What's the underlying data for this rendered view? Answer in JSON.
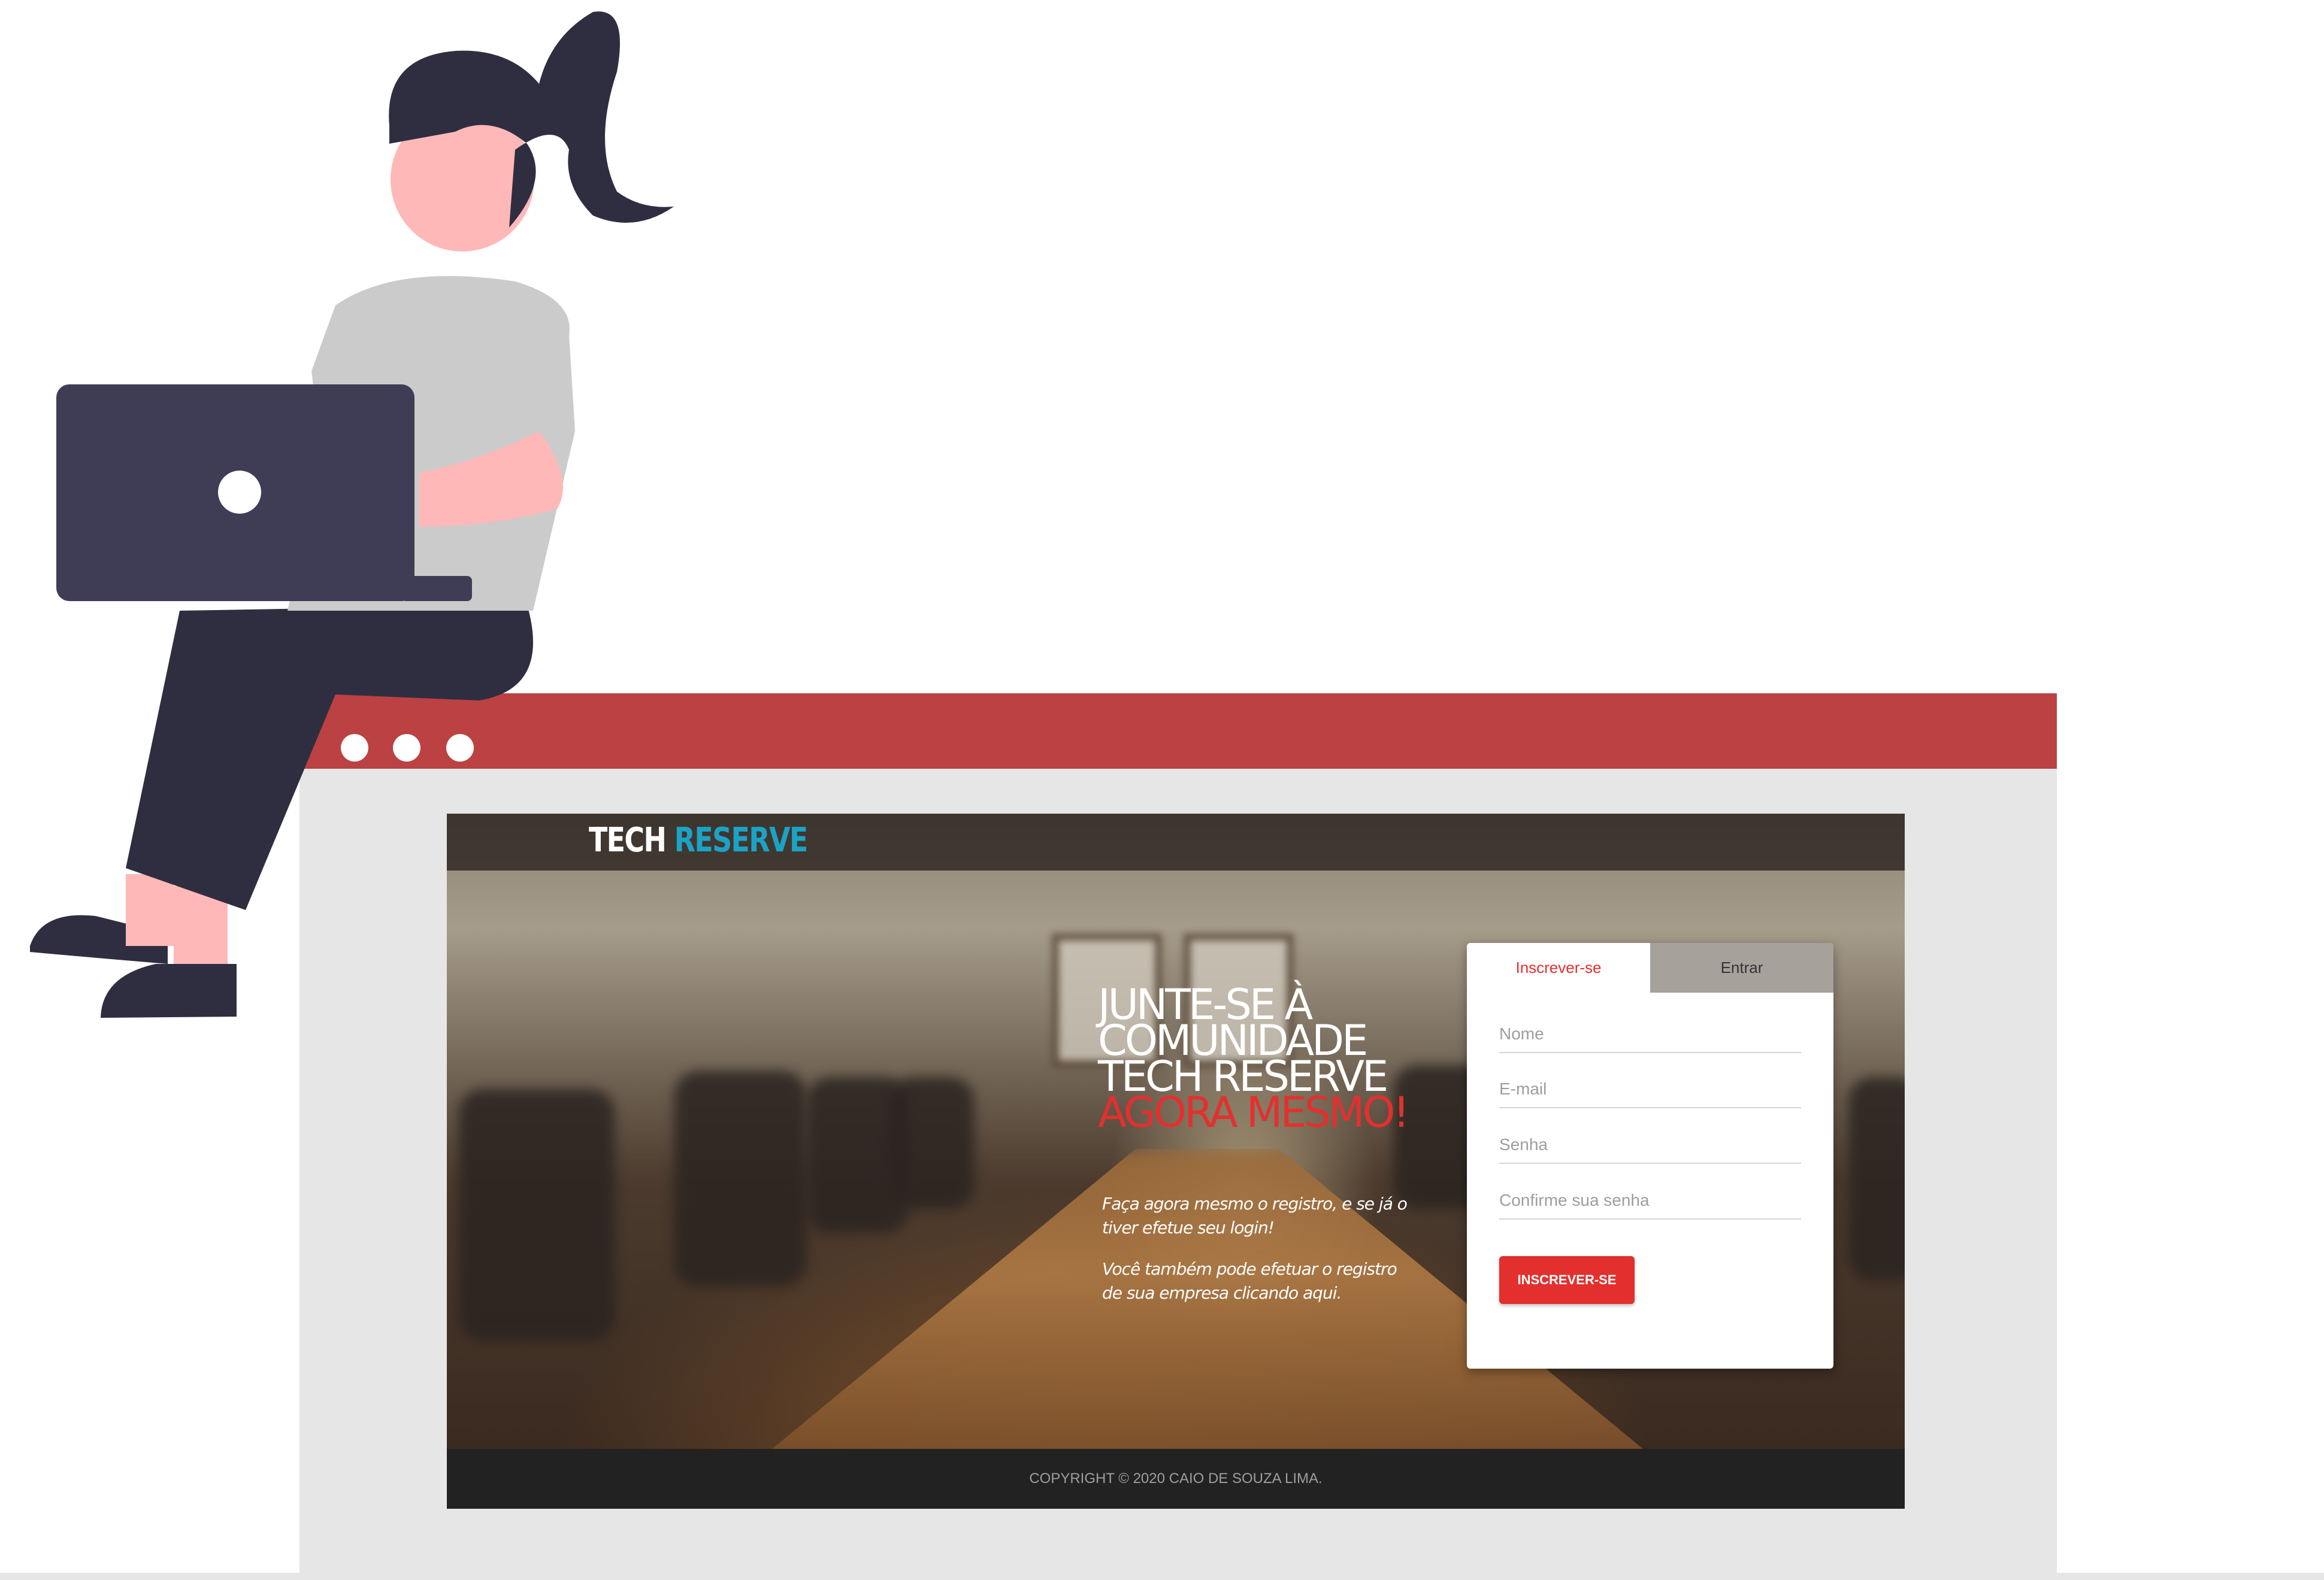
{
  "colors": {
    "browser_bar": "#bb4142",
    "accent_red": "#e3302e",
    "logo_blue": "#1ba3c6",
    "footer_bg": "#222222"
  },
  "site": {
    "logo_part1": "TECH",
    "logo_part2": "RESERVE",
    "headline_white": "JUNTE-SE À COMUNIDADE TECH RESERVE",
    "headline_red": "AGORA MESMO!",
    "paragraph1": "Faça agora mesmo o registro, e se já o tiver efetue seu login!",
    "paragraph2": "Você também pode efetuar o registro de sua empresa clicando aqui."
  },
  "form": {
    "tab_signup": "Inscrever-se",
    "tab_login": "Entrar",
    "name_placeholder": "Nome",
    "email_placeholder": "E-mail",
    "password_placeholder": "Senha",
    "confirm_placeholder": "Confirme sua senha",
    "submit_label": "INSCREVER-SE"
  },
  "footer": {
    "copyright": "COPYRIGHT © 2020 CAIO DE SOUZA LIMA."
  }
}
